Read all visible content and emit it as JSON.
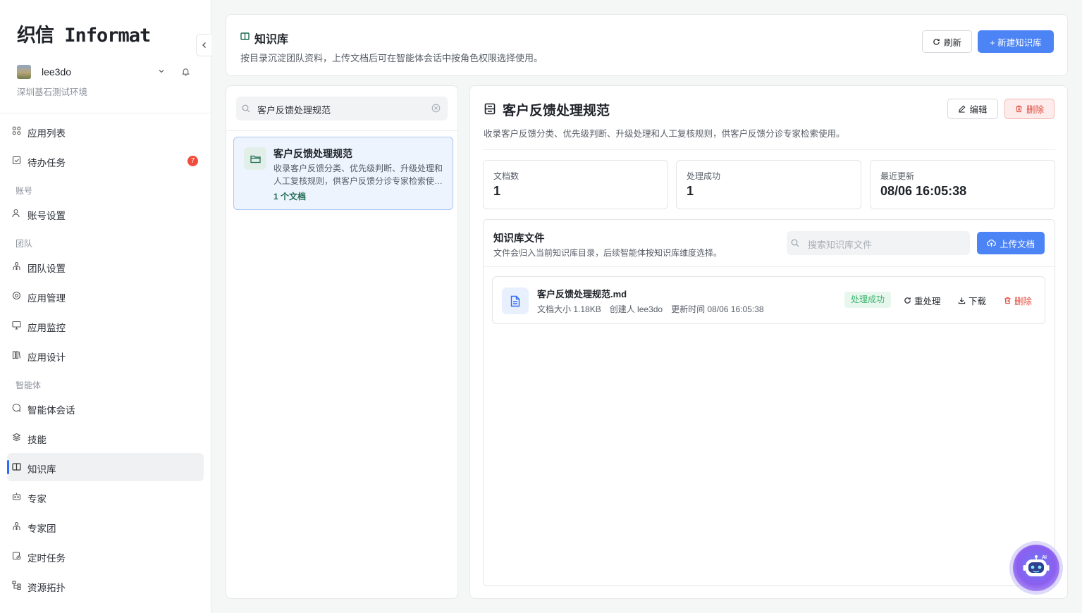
{
  "app": {
    "logo": "织信 Informat"
  },
  "user": {
    "name": "lee3do",
    "environment": "深圳基石测试环境"
  },
  "sidebar": {
    "items": [
      {
        "label": "应用列表",
        "icon": "apps-grid-icon"
      },
      {
        "label": "待办任务",
        "icon": "todo-check-icon",
        "badge": "7"
      }
    ],
    "sections": {
      "account": {
        "title": "账号",
        "items": [
          {
            "label": "账号设置",
            "icon": "user-settings-icon"
          }
        ]
      },
      "team": {
        "title": "团队",
        "items": [
          {
            "label": "团队设置",
            "icon": "team-icon"
          },
          {
            "label": "应用管理",
            "icon": "gear-icon"
          },
          {
            "label": "应用监控",
            "icon": "monitor-icon"
          },
          {
            "label": "应用设计",
            "icon": "design-icon"
          }
        ]
      },
      "agent": {
        "title": "智能体",
        "items": [
          {
            "label": "智能体会话",
            "icon": "chat-icon"
          },
          {
            "label": "技能",
            "icon": "layers-icon"
          },
          {
            "label": "知识库",
            "icon": "book-icon",
            "active": true
          },
          {
            "label": "专家",
            "icon": "robot-icon"
          },
          {
            "label": "专家团",
            "icon": "team-icon"
          },
          {
            "label": "定时任务",
            "icon": "clock-icon"
          },
          {
            "label": "资源拓扑",
            "icon": "topology-icon"
          }
        ]
      }
    }
  },
  "header": {
    "title": "知识库",
    "description": "按目录沉淀团队资料，上传文档后可在智能体会话中按角色权限选择使用。",
    "refresh_label": "刷新",
    "new_label": "+ 新建知识库"
  },
  "list": {
    "search_value": "客户反馈处理规范",
    "items": [
      {
        "name": "客户反馈处理规范",
        "description": "收录客户反馈分类、优先级判断、升级处理和人工复核规则，供客户反馈分诊专家检索使用。",
        "count": "1 个文档"
      }
    ]
  },
  "detail": {
    "title": "客户反馈处理规范",
    "description": "收录客户反馈分类、优先级判断、升级处理和人工复核规则，供客户反馈分诊专家检索使用。",
    "edit_label": "编辑",
    "delete_label": "删除",
    "stats": [
      {
        "label": "文档数",
        "value": "1"
      },
      {
        "label": "处理成功",
        "value": "1"
      },
      {
        "label": "最近更新",
        "value": "08/06 16:05:38"
      }
    ],
    "files": {
      "title": "知识库文件",
      "subtitle": "文件会归入当前知识库目录，后续智能体按知识库维度选择。",
      "search_placeholder": "搜索知识库文件",
      "upload_label": "上传文档",
      "rows": [
        {
          "name": "客户反馈处理规范.md",
          "size": "文档大小 1.18KB",
          "creator": "创建人 lee3do",
          "updated": "更新时间 08/06 16:05:38",
          "status": "处理成功",
          "reprocess_label": "重处理",
          "download_label": "下载",
          "delete_label": "删除"
        }
      ]
    }
  },
  "colors": {
    "primary": "#4c84f6",
    "success": "#35b36a",
    "danger": "#e0483a",
    "accent_green": "#1e6b52"
  }
}
